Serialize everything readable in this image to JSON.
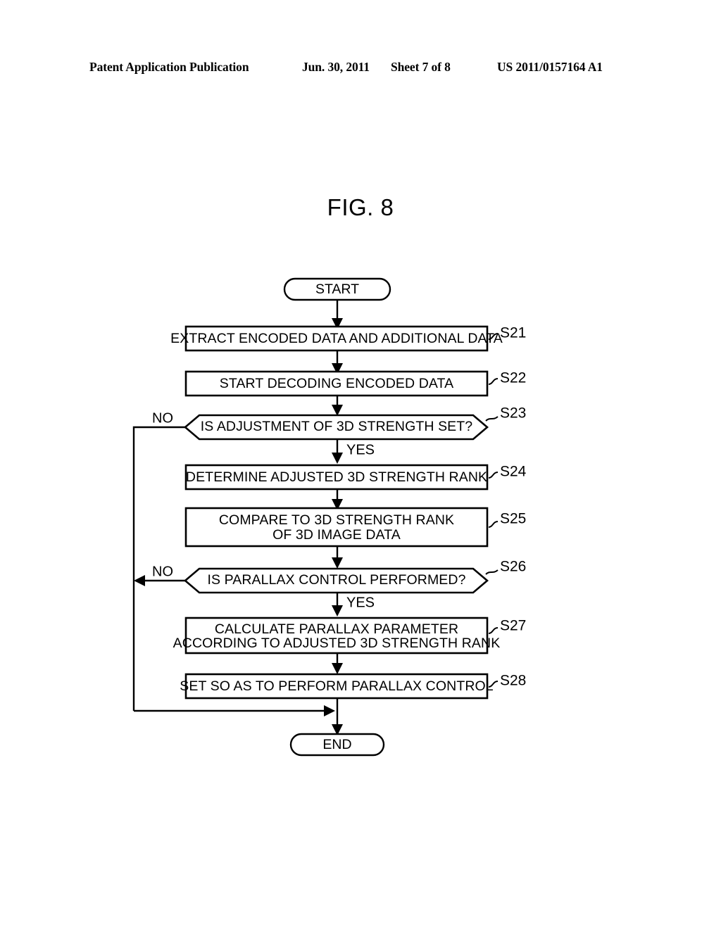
{
  "header": {
    "publication": "Patent Application Publication",
    "date": "Jun. 30, 2011",
    "sheet": "Sheet 7 of 8",
    "number": "US 2011/0157164 A1"
  },
  "figure": {
    "title": "FIG. 8"
  },
  "flowchart": {
    "start_label": "START",
    "end_label": "END",
    "steps": [
      {
        "id": "S21",
        "text_line1": "EXTRACT ENCODED DATA AND ADDITIONAL DATA",
        "text_line2": ""
      },
      {
        "id": "S22",
        "text_line1": "START DECODING ENCODED DATA",
        "text_line2": ""
      },
      {
        "id": "S23",
        "text_line1": "IS ADJUSTMENT OF 3D STRENGTH SET?",
        "text_line2": ""
      },
      {
        "id": "S24",
        "text_line1": "DETERMINE ADJUSTED 3D STRENGTH RANK",
        "text_line2": ""
      },
      {
        "id": "S25",
        "text_line1": "COMPARE TO 3D STRENGTH RANK",
        "text_line2": "OF 3D IMAGE DATA"
      },
      {
        "id": "S26",
        "text_line1": "IS PARALLAX CONTROL PERFORMED?",
        "text_line2": ""
      },
      {
        "id": "S27",
        "text_line1": "CALCULATE PARALLAX PARAMETER",
        "text_line2": "ACCORDING TO ADJUSTED 3D STRENGTH RANK"
      },
      {
        "id": "S28",
        "text_line1": "SET SO AS TO PERFORM PARALLAX CONTROL",
        "text_line2": ""
      }
    ],
    "branches": {
      "s23_no": "NO",
      "s23_yes": "YES",
      "s26_no": "NO",
      "s26_yes": "YES"
    }
  },
  "colors": {
    "ink": "#000000",
    "paper": "#ffffff"
  }
}
